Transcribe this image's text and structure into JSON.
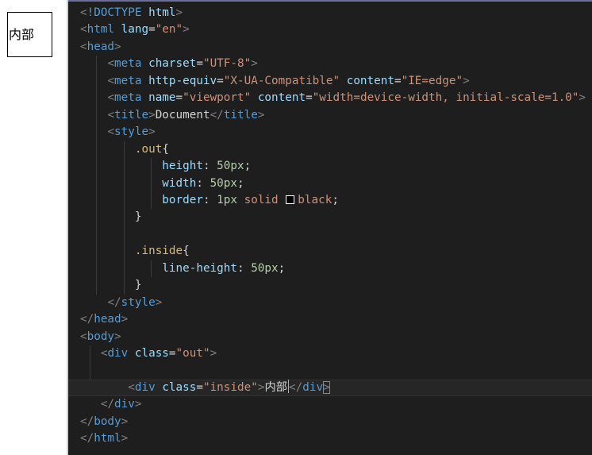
{
  "preview": {
    "inside_text": "内部"
  },
  "editor": {
    "lines": [
      [
        [
          "t-punc",
          "<"
        ],
        [
          "t-tag",
          "!DOCTYPE"
        ],
        [
          "t-text",
          " "
        ],
        [
          "t-attr",
          "html"
        ],
        [
          "t-punc",
          ">"
        ]
      ],
      [
        [
          "t-punc",
          "<"
        ],
        [
          "t-tag",
          "html"
        ],
        [
          "t-text",
          " "
        ],
        [
          "t-attr",
          "lang"
        ],
        [
          "t-text",
          "="
        ],
        [
          "t-str",
          "\"en\""
        ],
        [
          "t-punc",
          ">"
        ]
      ],
      [
        [
          "t-punc",
          "<"
        ],
        [
          "t-tag",
          "head"
        ],
        [
          "t-punc",
          ">"
        ]
      ],
      [
        [
          "t-text",
          "    "
        ],
        [
          "t-punc",
          "<"
        ],
        [
          "t-tag",
          "meta"
        ],
        [
          "t-text",
          " "
        ],
        [
          "t-attr",
          "charset"
        ],
        [
          "t-text",
          "="
        ],
        [
          "t-str",
          "\"UTF-8\""
        ],
        [
          "t-punc",
          ">"
        ]
      ],
      [
        [
          "t-text",
          "    "
        ],
        [
          "t-punc",
          "<"
        ],
        [
          "t-tag",
          "meta"
        ],
        [
          "t-text",
          " "
        ],
        [
          "t-attr",
          "http-equiv"
        ],
        [
          "t-text",
          "="
        ],
        [
          "t-str",
          "\"X-UA-Compatible\""
        ],
        [
          "t-text",
          " "
        ],
        [
          "t-attr",
          "content"
        ],
        [
          "t-text",
          "="
        ],
        [
          "t-str",
          "\"IE=edge\""
        ],
        [
          "t-punc",
          ">"
        ]
      ],
      [
        [
          "t-text",
          "    "
        ],
        [
          "t-punc",
          "<"
        ],
        [
          "t-tag",
          "meta"
        ],
        [
          "t-text",
          " "
        ],
        [
          "t-attr",
          "name"
        ],
        [
          "t-text",
          "="
        ],
        [
          "t-str",
          "\"viewport\""
        ],
        [
          "t-text",
          " "
        ],
        [
          "t-attr",
          "content"
        ],
        [
          "t-text",
          "="
        ],
        [
          "t-str",
          "\"width=device-width, initial-scale=1.0\""
        ],
        [
          "t-punc",
          ">"
        ]
      ],
      [
        [
          "t-text",
          "    "
        ],
        [
          "t-punc",
          "<"
        ],
        [
          "t-tag",
          "title"
        ],
        [
          "t-punc",
          ">"
        ],
        [
          "t-text",
          "Document"
        ],
        [
          "t-punc",
          "</"
        ],
        [
          "t-tag",
          "title"
        ],
        [
          "t-punc",
          ">"
        ]
      ],
      [
        [
          "t-text",
          "    "
        ],
        [
          "t-punc",
          "<"
        ],
        [
          "t-tag",
          "style"
        ],
        [
          "t-punc",
          ">"
        ]
      ],
      [
        [
          "t-text",
          "        "
        ],
        [
          "t-sel",
          ".out"
        ],
        [
          "t-text",
          "{"
        ]
      ],
      [
        [
          "t-text",
          "            "
        ],
        [
          "t-prop",
          "height"
        ],
        [
          "t-text",
          ": "
        ],
        [
          "t-num",
          "50px"
        ],
        [
          "t-text",
          ";"
        ]
      ],
      [
        [
          "t-text",
          "            "
        ],
        [
          "t-prop",
          "width"
        ],
        [
          "t-text",
          ": "
        ],
        [
          "t-num",
          "50px"
        ],
        [
          "t-text",
          ";"
        ]
      ],
      [
        [
          "t-text",
          "            "
        ],
        [
          "t-prop",
          "border"
        ],
        [
          "t-text",
          ": "
        ],
        [
          "t-num",
          "1px"
        ],
        [
          "t-text",
          " "
        ],
        [
          "t-kw",
          "solid"
        ],
        [
          "t-text",
          " "
        ],
        [
          "swatch",
          ""
        ],
        [
          "t-kw",
          "black"
        ],
        [
          "t-text",
          ";"
        ]
      ],
      [
        [
          "t-text",
          "        }"
        ]
      ],
      [
        [
          "t-text",
          ""
        ]
      ],
      [
        [
          "t-text",
          "        "
        ],
        [
          "t-sel",
          ".inside"
        ],
        [
          "t-text",
          "{"
        ]
      ],
      [
        [
          "t-text",
          "            "
        ],
        [
          "t-prop",
          "line-height"
        ],
        [
          "t-text",
          ": "
        ],
        [
          "t-num",
          "50px"
        ],
        [
          "t-text",
          ";"
        ]
      ],
      [
        [
          "t-text",
          "        }"
        ]
      ],
      [
        [
          "t-text",
          "    "
        ],
        [
          "t-punc",
          "</"
        ],
        [
          "t-tag",
          "style"
        ],
        [
          "t-punc",
          ">"
        ]
      ],
      [
        [
          "t-punc",
          "</"
        ],
        [
          "t-tag",
          "head"
        ],
        [
          "t-punc",
          ">"
        ]
      ],
      [
        [
          "t-punc",
          "<"
        ],
        [
          "t-tag",
          "body"
        ],
        [
          "t-punc",
          ">"
        ]
      ],
      [
        [
          "t-text",
          "   "
        ],
        [
          "t-punc",
          "<"
        ],
        [
          "t-tag",
          "div"
        ],
        [
          "t-text",
          " "
        ],
        [
          "t-attr",
          "class"
        ],
        [
          "t-text",
          "="
        ],
        [
          "t-str",
          "\"out\""
        ],
        [
          "t-punc",
          ">"
        ]
      ],
      [
        [
          "t-text",
          ""
        ]
      ],
      [
        [
          "t-text",
          "       "
        ],
        [
          "t-punc",
          "<"
        ],
        [
          "t-tag",
          "div"
        ],
        [
          "t-text",
          " "
        ],
        [
          "t-attr",
          "class"
        ],
        [
          "t-text",
          "="
        ],
        [
          "t-str",
          "\"inside\""
        ],
        [
          "t-punc",
          ">"
        ],
        [
          "t-text",
          "内部"
        ],
        [
          "cursor",
          ""
        ],
        [
          "t-punc",
          "</"
        ],
        [
          "t-tag",
          "div"
        ],
        [
          "match",
          ">"
        ]
      ],
      [
        [
          "t-text",
          "   "
        ],
        [
          "t-punc",
          "</"
        ],
        [
          "t-tag",
          "div"
        ],
        [
          "t-punc",
          ">"
        ]
      ],
      [
        [
          "t-punc",
          "</"
        ],
        [
          "t-tag",
          "body"
        ],
        [
          "t-punc",
          ">"
        ]
      ],
      [
        [
          "t-punc",
          "</"
        ],
        [
          "t-tag",
          "html"
        ],
        [
          "t-punc",
          ">"
        ]
      ]
    ],
    "current_line": 22
  }
}
